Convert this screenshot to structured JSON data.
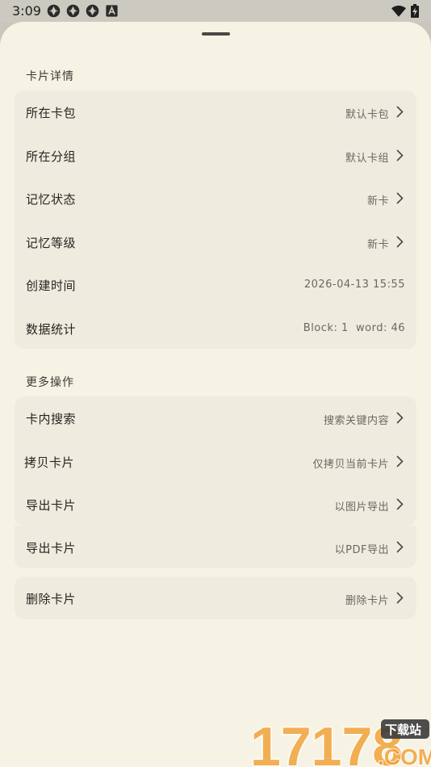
{
  "status_bar": {
    "time": "3:09",
    "left_icons": [
      "aperture-icon",
      "aperture-icon",
      "aperture-icon",
      "text-a-icon"
    ],
    "right_icons": [
      "wifi-icon",
      "battery-icon"
    ]
  },
  "sections": {
    "details": {
      "title": "卡片详情",
      "rows": [
        {
          "label": "所在卡包",
          "value": "默认卡包"
        },
        {
          "label": "所在分组",
          "value": "默认卡组"
        },
        {
          "label": "记忆状态",
          "value": "新卡"
        },
        {
          "label": "记忆等级",
          "value": "新卡"
        },
        {
          "label": "创建时间",
          "value": "2026-04-13 15:55"
        },
        {
          "label": "数据统计",
          "value": "Block: 1  word: 46"
        }
      ]
    },
    "more": {
      "title": "更多操作",
      "rows": [
        {
          "label": "卡内搜索",
          "value": "搜索关键内容"
        },
        {
          "label": "拷贝卡片",
          "value": "仅拷贝当前卡片"
        },
        {
          "label": "导出卡片",
          "value": "以图片导出"
        }
      ]
    },
    "export_pdf": {
      "label": "导出卡片",
      "value": "以PDF导出"
    },
    "delete": {
      "label": "删除卡片",
      "value": "删除卡片"
    }
  },
  "watermark": {
    "main": "17178",
    "tag": "下载站",
    "domain": ".COM"
  },
  "colors": {
    "sheet_bg": "#f7f3e4",
    "card_bg": "#efebdf",
    "watermark_orange": "#f2a33a"
  }
}
